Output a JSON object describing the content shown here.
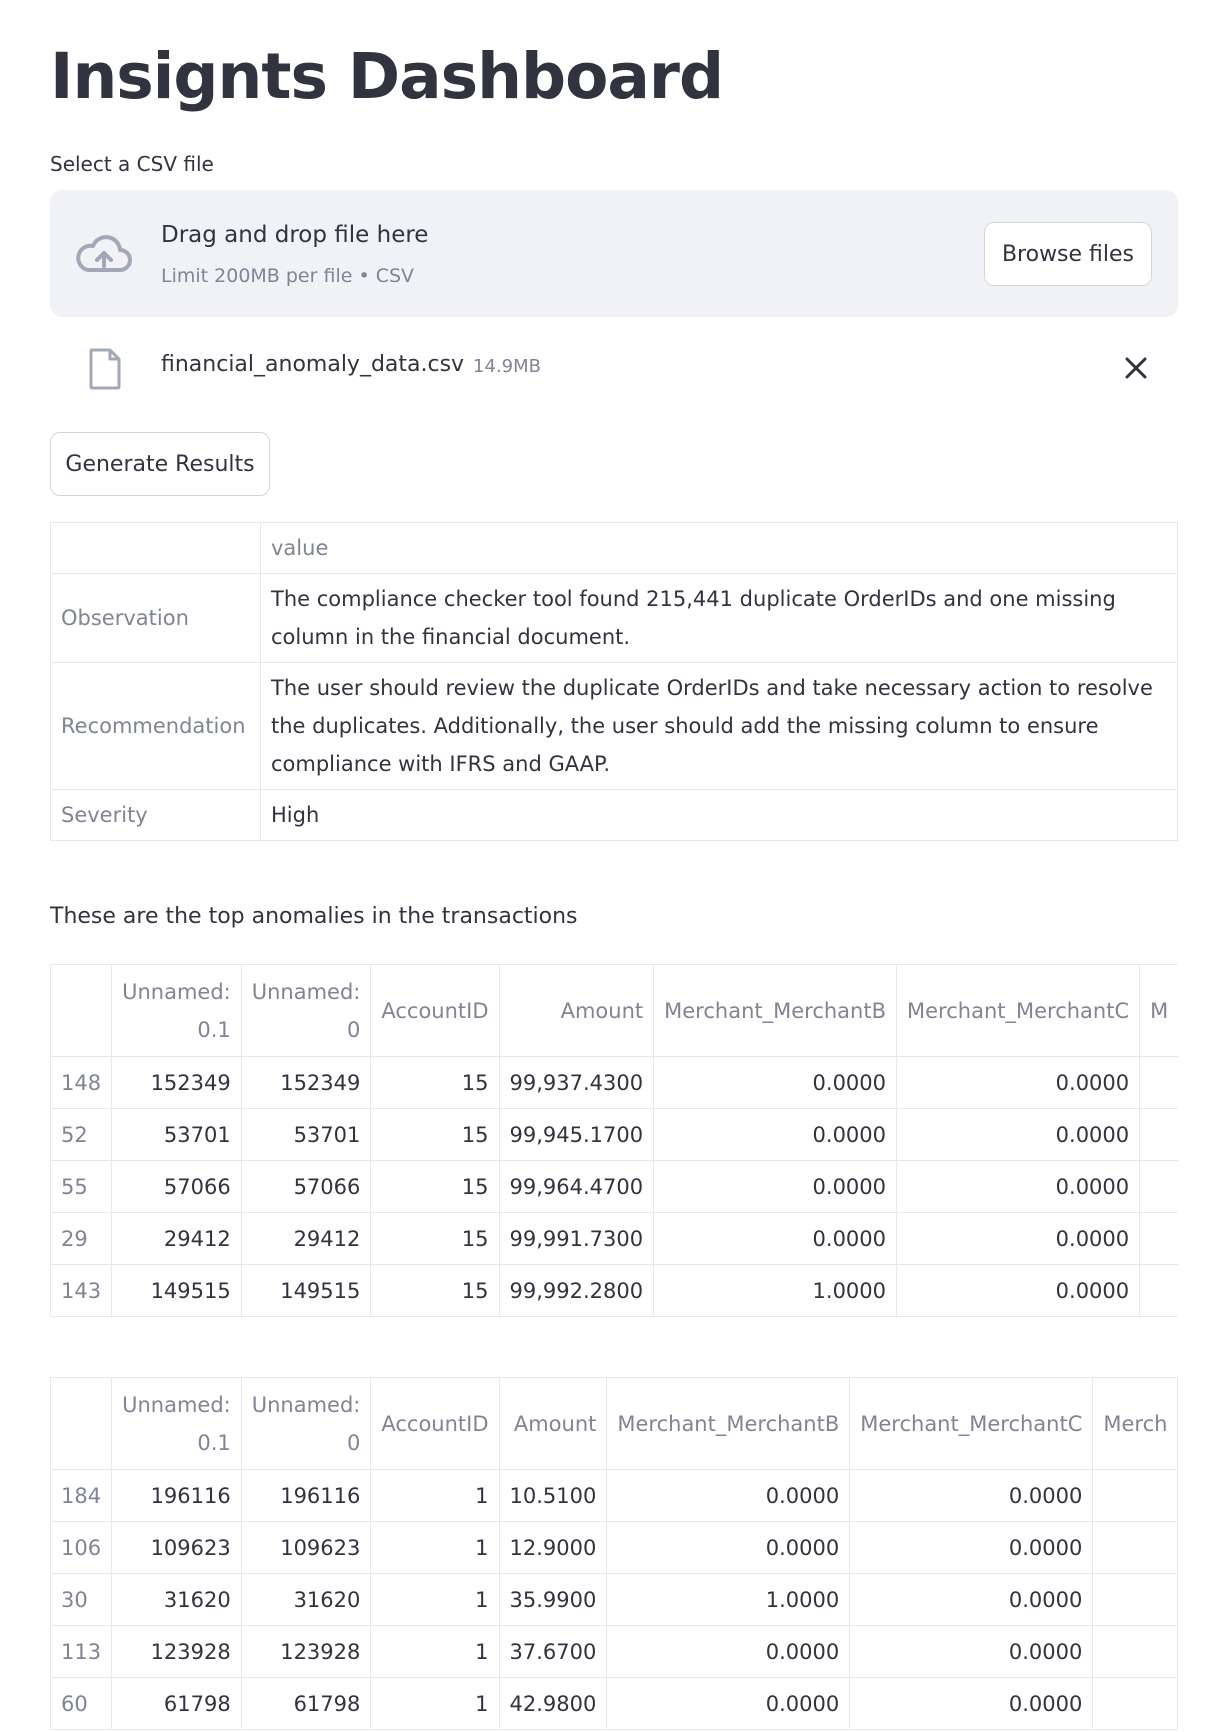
{
  "page": {
    "title": "Insignts Dashboard"
  },
  "uploader": {
    "label": "Select a CSV file",
    "drop_title": "Drag and drop file here",
    "drop_subtitle": "Limit 200MB per file • CSV",
    "browse_label": "Browse files",
    "file": {
      "name": "financial_anomaly_data.csv",
      "size": "14.9MB"
    }
  },
  "actions": {
    "generate_label": "Generate Results"
  },
  "results": {
    "header": "value",
    "rows": [
      {
        "key": "Observation",
        "value": "The compliance checker tool found 215,441 duplicate OrderIDs and one missing column in the financial document."
      },
      {
        "key": "Recommendation",
        "value": "The user should review the duplicate OrderIDs and take necessary action to resolve the duplicates. Additionally, the user should add the missing column to ensure compliance with IFRS and GAAP."
      },
      {
        "key": "Severity",
        "value": "High"
      }
    ]
  },
  "anomalies": {
    "caption": "These are the top anomalies in the transactions",
    "columns": {
      "c1": [
        "Unnamed:",
        "0.1"
      ],
      "c2": [
        "Unnamed:",
        "0"
      ],
      "c3": "AccountID",
      "c4": "Amount",
      "c5": "Merchant_MerchantB",
      "c6": "Merchant_MerchantC"
    },
    "table1": {
      "cut_header": "M",
      "rows": [
        [
          "148",
          "152349",
          "152349",
          "15",
          "99,937.4300",
          "0.0000",
          "0.0000"
        ],
        [
          "52",
          "53701",
          "53701",
          "15",
          "99,945.1700",
          "0.0000",
          "0.0000"
        ],
        [
          "55",
          "57066",
          "57066",
          "15",
          "99,964.4700",
          "0.0000",
          "0.0000"
        ],
        [
          "29",
          "29412",
          "29412",
          "15",
          "99,991.7300",
          "0.0000",
          "0.0000"
        ],
        [
          "143",
          "149515",
          "149515",
          "15",
          "99,992.2800",
          "1.0000",
          "0.0000"
        ]
      ]
    },
    "table2": {
      "cut_header": "Merch",
      "rows": [
        [
          "184",
          "196116",
          "196116",
          "1",
          "10.5100",
          "0.0000",
          "0.0000"
        ],
        [
          "106",
          "109623",
          "109623",
          "1",
          "12.9000",
          "0.0000",
          "0.0000"
        ],
        [
          "30",
          "31620",
          "31620",
          "1",
          "35.9900",
          "1.0000",
          "0.0000"
        ],
        [
          "113",
          "123928",
          "123928",
          "1",
          "37.6700",
          "0.0000",
          "0.0000"
        ],
        [
          "60",
          "61798",
          "61798",
          "1",
          "42.9800",
          "0.0000",
          "0.0000"
        ]
      ]
    }
  },
  "icons": {
    "upload": "cloud-upload-icon",
    "file": "file-icon",
    "close": "close-icon"
  },
  "colors": {
    "text": "#31333f",
    "muted": "#808495",
    "dropzone_bg": "#f0f2f6",
    "border": "#e6e8ec"
  }
}
